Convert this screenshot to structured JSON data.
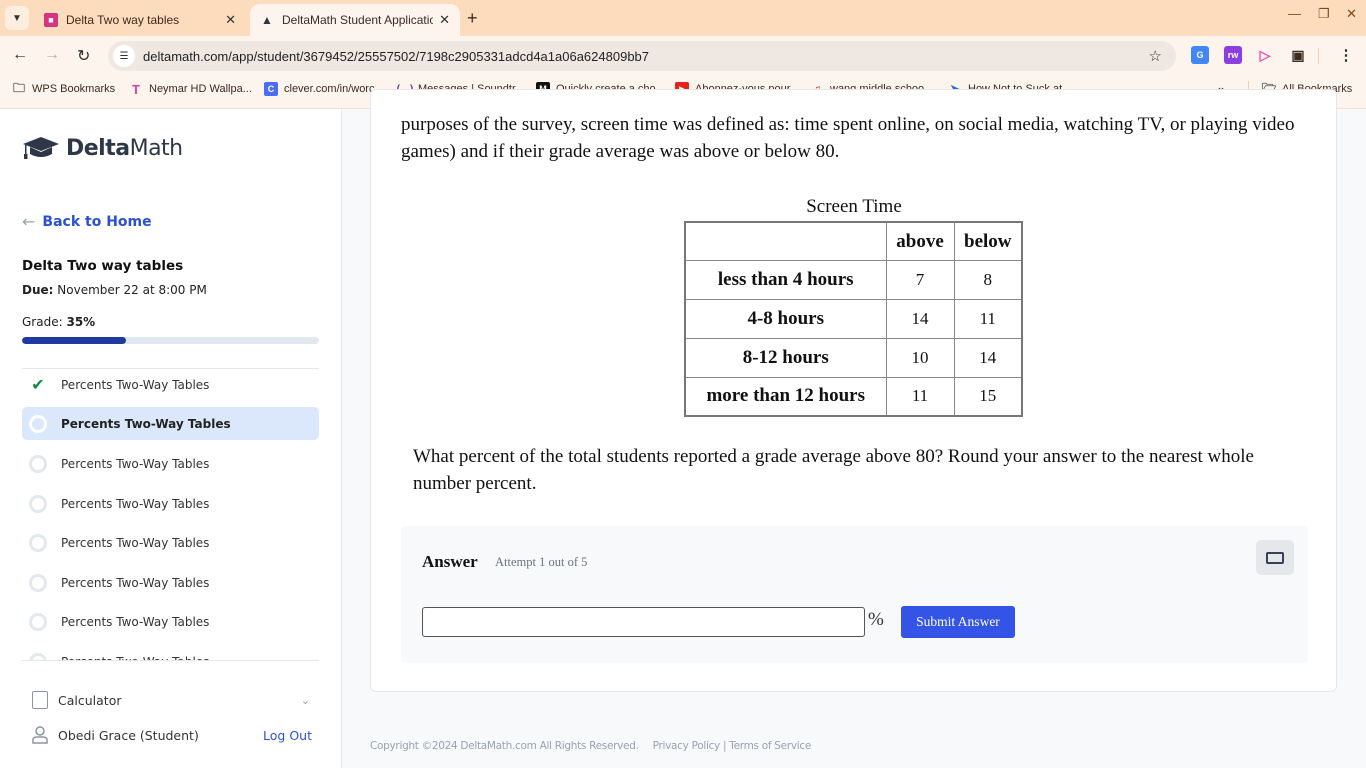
{
  "browser": {
    "tabs": [
      {
        "title": "Delta Two way tables",
        "active": false,
        "favicon_color": "#d63384"
      },
      {
        "title": "DeltaMath Student Application",
        "active": true,
        "favicon_color": "#2d3748"
      }
    ],
    "url": "deltamath.com/app/student/3679452/25557502/7198c2905331adcd4a1a06a624809bb7",
    "bookmarks": [
      {
        "label": "WPS Bookmarks",
        "icon": "folder-icon"
      },
      {
        "label": "Neymar HD Wallpa...",
        "icon": "t-logo-icon"
      },
      {
        "label": "clever.com/in/worc...",
        "icon": "clever-icon"
      },
      {
        "label": "Messages | Soundtr...",
        "icon": "soundtrap-icon"
      },
      {
        "label": "Quickly create a cho...",
        "icon": "mc-icon"
      },
      {
        "label": "Abonnez-vous pour...",
        "icon": "youtube-icon"
      },
      {
        "label": "wang middle schoo...",
        "icon": "music-icon"
      },
      {
        "label": "How Not to Suck at...",
        "icon": "bird-icon"
      }
    ],
    "all_bookmarks_label": "All Bookmarks"
  },
  "sidebar": {
    "brand_bold": "Delta",
    "brand_light": "Math",
    "back_label": "Back to Home",
    "assignment_title": "Delta Two way tables",
    "due_label": "Due:",
    "due_value": "November 22 at 8:00 PM",
    "grade_label": "Grade:",
    "grade_value": "35%",
    "grade_fraction": 0.35,
    "problems": [
      {
        "label": "Percents Two-Way Tables",
        "status": "complete"
      },
      {
        "label": "Percents Two-Way Tables",
        "status": "current"
      },
      {
        "label": "Percents Two-Way Tables",
        "status": "incomplete"
      },
      {
        "label": "Percents Two-Way Tables",
        "status": "incomplete"
      },
      {
        "label": "Percents Two-Way Tables",
        "status": "incomplete"
      },
      {
        "label": "Percents Two-Way Tables",
        "status": "incomplete"
      },
      {
        "label": "Percents Two-Way Tables",
        "status": "incomplete"
      },
      {
        "label": "Percents Two-Way Tables",
        "status": "incomplete"
      }
    ],
    "calculator_label": "Calculator",
    "user_name": "Obedi Grace (Student)",
    "logout_label": "Log Out"
  },
  "problem": {
    "intro": "purposes of the survey, screen time was defined as: time spent online, on social media, watching TV, or playing video games) and if their grade average was above or below 80.",
    "table": {
      "caption": "Screen Time",
      "columns": [
        "",
        "above",
        "below"
      ],
      "rows": [
        {
          "label": "less than 4 hours",
          "above": "7",
          "below": "8"
        },
        {
          "label": "4-8 hours",
          "above": "14",
          "below": "11"
        },
        {
          "label": "8-12 hours",
          "above": "10",
          "below": "14"
        },
        {
          "label": "more than 12 hours",
          "above": "11",
          "below": "15"
        }
      ]
    },
    "question": "What percent of the total students reported a grade average above 80? Round your answer to the nearest whole number percent.",
    "answer": {
      "label": "Answer",
      "attempt": "Attempt 1 out of 5",
      "value": "",
      "unit": "%",
      "submit_label": "Submit Answer"
    }
  },
  "footer": {
    "copyright": "Copyright ©2024 DeltaMath.com All Rights Reserved.",
    "links": "Privacy Policy | Terms of Service"
  }
}
